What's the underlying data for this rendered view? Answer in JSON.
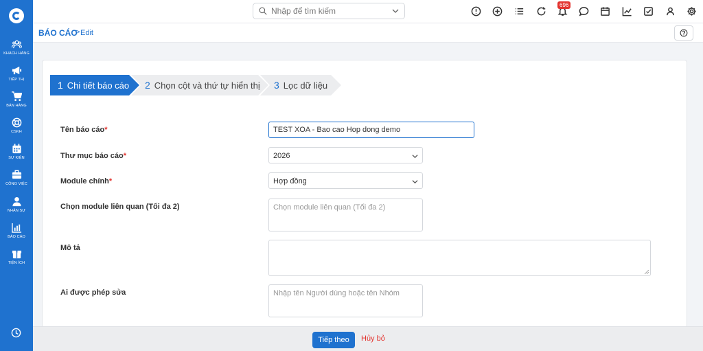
{
  "sidebar": {
    "items": [
      {
        "label": "KHÁCH HÀNG",
        "icon": "customers-icon"
      },
      {
        "label": "TIẾP THỊ",
        "icon": "megaphone-icon"
      },
      {
        "label": "BÁN HÀNG",
        "icon": "cart-icon"
      },
      {
        "label": "CSKH",
        "icon": "lifebuoy-icon"
      },
      {
        "label": "SỰ KIỆN",
        "icon": "calendar-icon"
      },
      {
        "label": "CÔNG VIỆC",
        "icon": "briefcase-icon"
      },
      {
        "label": "NHÂN SỰ",
        "icon": "person-icon"
      },
      {
        "label": "BÁO CÁO",
        "icon": "report-icon"
      },
      {
        "label": "TIỆN ÍCH",
        "icon": "package-icon"
      }
    ]
  },
  "topbar": {
    "search_placeholder": "Nhập để tìm kiếm",
    "notification_count": "696"
  },
  "breadcrumb": {
    "main": "BÁO CÁO",
    "separator": ">",
    "sub": "Edit"
  },
  "steps": [
    {
      "num": "1",
      "label": "Chi tiết báo cáo",
      "active": true
    },
    {
      "num": "2",
      "label": "Chọn cột và thứ tự hiển thị",
      "active": false
    },
    {
      "num": "3",
      "label": "Lọc dữ liệu",
      "active": false
    }
  ],
  "form": {
    "report_name": {
      "label": "Tên báo cáo",
      "value": "TEST XOA - Bao cao Hop dong demo"
    },
    "report_folder": {
      "label": "Thư mục báo cáo",
      "value": "2026"
    },
    "main_module": {
      "label": "Module chính",
      "value": "Hợp đồng"
    },
    "related_modules": {
      "label": "Chọn module liên quan (Tối đa 2)",
      "placeholder": "Chọn module liên quan (Tối đa 2)"
    },
    "description": {
      "label": "Mô tả",
      "value": ""
    },
    "editors": {
      "label": "Ai được phép sửa",
      "placeholder": "Nhập tên Người dùng hoặc tên Nhóm"
    },
    "required_mark": "*"
  },
  "footer": {
    "next_label": "Tiếp theo",
    "cancel_label": "Hủy bỏ"
  },
  "colors": {
    "primary": "#1f72cf",
    "danger": "#e3342f"
  }
}
